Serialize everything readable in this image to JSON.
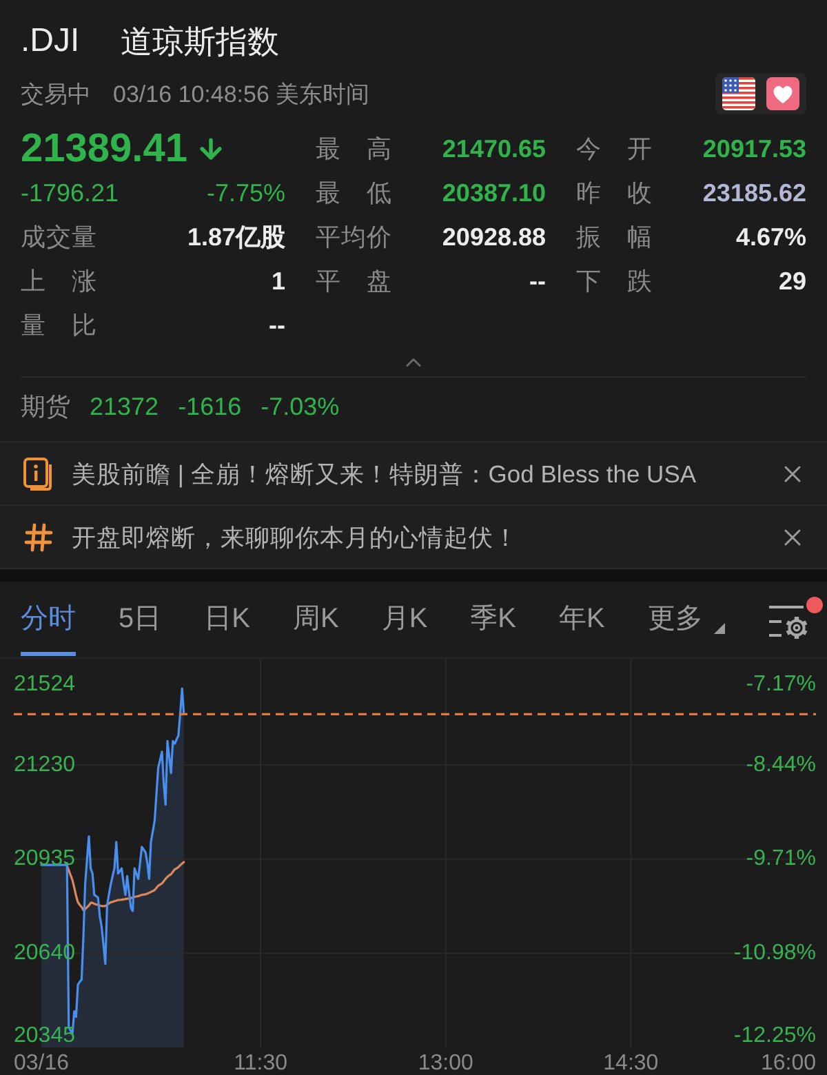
{
  "header": {
    "symbol": ".DJI",
    "name": "道琼斯指数",
    "status": "交易中",
    "timestamp": "03/16 10:48:56 美东时间",
    "favorited": true
  },
  "quote": {
    "price": "21389.41",
    "falling": true,
    "change": "-1796.21",
    "change_percent": "-7.75%"
  },
  "stats": [
    {
      "label": "最 高",
      "value": "21470.65",
      "color": "#2fb44c"
    },
    {
      "label": "今 开",
      "value": "20917.53",
      "color": "#2fb44c"
    },
    {
      "label": "最 低",
      "value": "20387.10",
      "color": "#2fb44c"
    },
    {
      "label": "昨 收",
      "value": "23185.62",
      "color": "#b4b7d6"
    },
    {
      "label": "成交量",
      "value": "1.87亿股",
      "color": "#ececec"
    },
    {
      "label": "平均价",
      "value": "20928.88",
      "color": "#ececec"
    },
    {
      "label": "振 幅",
      "value": "4.67%",
      "color": "#ececec"
    },
    {
      "label": "上 涨",
      "value": "1",
      "color": "#ececec"
    },
    {
      "label": "平 盘",
      "value": "--",
      "color": "#ececec"
    },
    {
      "label": "下 跌",
      "value": "29",
      "color": "#ececec"
    },
    {
      "label": "量 比",
      "value": "--",
      "color": "#ececec"
    }
  ],
  "futures": {
    "label": "期货",
    "price": "21372",
    "change": "-1616",
    "change_percent": "-7.03%",
    "falling": true
  },
  "news": [
    {
      "kind": "info",
      "text": "美股前瞻 | 全崩！熔断又来！特朗普：God Bless the USA"
    },
    {
      "kind": "topic",
      "text": "开盘即熔断，来聊聊你本月的心情起伏！"
    }
  ],
  "chart_tabs": {
    "items": [
      {
        "label": "分时",
        "selected": true,
        "kind": "period"
      },
      {
        "label": "5日",
        "selected": false,
        "kind": "period"
      },
      {
        "label": "日K",
        "selected": false,
        "kind": "period"
      },
      {
        "label": "周K",
        "selected": false,
        "kind": "period"
      },
      {
        "label": "月K",
        "selected": false,
        "kind": "period"
      },
      {
        "label": "季K",
        "selected": false,
        "kind": "period"
      },
      {
        "label": "年K",
        "selected": false,
        "kind": "period"
      },
      {
        "label": "更多",
        "selected": false,
        "kind": "menu"
      }
    ],
    "settings_notice": true
  },
  "chart": {
    "percent_labels": [
      "-7.17%",
      "-8.44%",
      "-9.71%",
      "-10.98%",
      "-12.25%"
    ],
    "chart_data": {
      "type": "line",
      "grid": true,
      "categories": [
        "03/16",
        null,
        null,
        null,
        null,
        null,
        null,
        null,
        null,
        null,
        null,
        null,
        null,
        null,
        null,
        null,
        null,
        null,
        null,
        null,
        null,
        null,
        null,
        null,
        null,
        null,
        null,
        null,
        null,
        null,
        null,
        null,
        null,
        null,
        null,
        null,
        null,
        null,
        null,
        null,
        null,
        null,
        null,
        null,
        null,
        null,
        null,
        null,
        null,
        null,
        null,
        null,
        null,
        null,
        null,
        null,
        null,
        null,
        null,
        null,
        null,
        null,
        null,
        null,
        null,
        null,
        null,
        null,
        null,
        null,
        null,
        null,
        null,
        null,
        null,
        null,
        null,
        null,
        null,
        null,
        null,
        null,
        null,
        null,
        null,
        null,
        null,
        null,
        null,
        null,
        null,
        null,
        null,
        null,
        null,
        null,
        null,
        null,
        null,
        null,
        null,
        null,
        null,
        null,
        null,
        null,
        null,
        null,
        null,
        null,
        null,
        null,
        null,
        null,
        null,
        null,
        null,
        null,
        null,
        null,
        "11:30",
        null,
        null,
        null,
        null,
        null,
        null,
        null,
        null,
        null,
        null,
        null,
        null,
        null,
        null,
        null,
        null,
        null,
        null,
        null,
        null,
        null,
        null,
        null,
        null,
        null,
        null,
        null,
        null,
        null,
        null,
        null,
        null,
        null,
        null,
        null,
        null,
        null,
        null,
        null,
        null,
        null,
        null,
        null,
        null,
        null,
        null,
        null,
        null,
        null,
        null,
        null,
        null,
        null,
        null,
        null,
        null,
        null,
        null,
        null,
        null,
        null,
        null,
        null,
        null,
        null,
        null,
        null,
        null,
        null,
        null,
        null,
        null,
        null,
        null,
        null,
        null,
        null,
        null,
        null,
        null,
        null,
        null,
        null,
        null,
        null,
        null,
        null,
        null,
        null,
        "13:00",
        null,
        null,
        null,
        null,
        null,
        null,
        null,
        null,
        null,
        null,
        null,
        null,
        null,
        null,
        null,
        null,
        null,
        null,
        null,
        null,
        null,
        null,
        null,
        null,
        null,
        null,
        null,
        null,
        null,
        null,
        null,
        null,
        null,
        null,
        null,
        null,
        null,
        null,
        null,
        null,
        null,
        null,
        null,
        null,
        null,
        null,
        null,
        null,
        null,
        null,
        null,
        null,
        null,
        null,
        null,
        null,
        null,
        null,
        null,
        null,
        null,
        null,
        null,
        null,
        null,
        null,
        null,
        null,
        null,
        null,
        null,
        null,
        null,
        null,
        null,
        null,
        null,
        null,
        null,
        null,
        null,
        null,
        null,
        null,
        null,
        null,
        null,
        null,
        null,
        "14:30",
        null,
        null,
        null,
        null,
        null,
        null,
        null,
        null,
        null,
        null,
        null,
        null,
        null,
        null,
        null,
        null,
        null,
        null,
        null,
        null,
        null,
        null,
        null,
        null,
        null,
        null,
        null,
        null,
        null,
        null,
        null,
        null,
        null,
        null,
        null,
        null,
        null,
        null,
        null,
        null,
        null,
        null,
        null,
        null,
        null,
        null,
        null,
        null,
        null,
        null,
        null,
        null,
        null,
        null,
        null,
        null,
        null,
        null,
        null,
        null,
        null,
        null,
        null,
        null,
        null,
        null,
        null,
        null,
        null,
        null,
        null,
        null,
        null,
        null,
        null,
        null,
        null,
        null,
        null,
        null,
        null,
        null,
        null,
        null,
        null,
        null,
        null,
        null,
        null,
        "16:00"
      ],
      "series": [
        {
          "color": "#4a8ff0",
          "values": [
            20917,
            20917,
            20917,
            20917,
            20917,
            20917,
            20917,
            20917,
            20917,
            20917,
            20917,
            20917,
            20917,
            20917,
            20923,
            20408,
            20398,
            20387,
            20458,
            20441,
            20541,
            20550,
            20558,
            20691,
            20857,
            20932,
            21006,
            20906,
            20890,
            20823,
            20819,
            20815,
            20757,
            20724,
            20666,
            20607,
            20790,
            20823,
            20857,
            20882,
            20906,
            20989,
            20890,
            20898,
            20906,
            20857,
            20823,
            20882,
            20832,
            20782,
            20773,
            20906,
            20890,
            20873,
            20923,
            20973,
            20965,
            20956,
            20923,
            20873,
            20989,
            21023,
            21056,
            21139,
            21222,
            21247,
            21272,
            21172,
            21106,
            21305,
            21255,
            21205,
            21305,
            21297,
            21310,
            21322,
            21388,
            21470,
            21389,
            null,
            null,
            null,
            null,
            null,
            null,
            null,
            null,
            null,
            null,
            null,
            null,
            null,
            null,
            null,
            null,
            null,
            null,
            null,
            null,
            null,
            null,
            null,
            null,
            null,
            null,
            null,
            null,
            null,
            null,
            null,
            null,
            null,
            null,
            null,
            null,
            null,
            null,
            null,
            null,
            null,
            null,
            null,
            null,
            null,
            null,
            null,
            null,
            null,
            null,
            null,
            null,
            null,
            null,
            null,
            null,
            null,
            null,
            null,
            null,
            null,
            null,
            null,
            null,
            null,
            null,
            null,
            null,
            null,
            null,
            null,
            null,
            null,
            null,
            null,
            null,
            null,
            null,
            null,
            null,
            null,
            null,
            null,
            null,
            null,
            null,
            null,
            null,
            null,
            null,
            null,
            null,
            null,
            null,
            null,
            null,
            null,
            null,
            null,
            null,
            null,
            null,
            null,
            null,
            null,
            null,
            null,
            null,
            null,
            null,
            null,
            null,
            null,
            null,
            null,
            null,
            null,
            null,
            null,
            null,
            null,
            null,
            null,
            null,
            null,
            null,
            null,
            null,
            null,
            null,
            null,
            null,
            null,
            null,
            null,
            null,
            null,
            null,
            null,
            null,
            null,
            null,
            null,
            null,
            null,
            null,
            null,
            null,
            null,
            null,
            null,
            null,
            null,
            null,
            null,
            null,
            null,
            null,
            null,
            null,
            null,
            null,
            null,
            null,
            null,
            null,
            null,
            null,
            null,
            null,
            null,
            null,
            null,
            null,
            null,
            null,
            null,
            null,
            null,
            null,
            null,
            null,
            null,
            null,
            null,
            null,
            null,
            null,
            null,
            null,
            null,
            null,
            null,
            null,
            null,
            null,
            null,
            null,
            null,
            null,
            null,
            null,
            null,
            null,
            null,
            null,
            null,
            null,
            null,
            null,
            null,
            null,
            null,
            null,
            null,
            null,
            null,
            null,
            null,
            null,
            null,
            null,
            null,
            null,
            null,
            null,
            null,
            null,
            null,
            null,
            null,
            null,
            null,
            null,
            null,
            null,
            null,
            null,
            null,
            null,
            null,
            null,
            null,
            null,
            null,
            null,
            null,
            null,
            null,
            null,
            null,
            null,
            null,
            null,
            null,
            null,
            null,
            null,
            null,
            null,
            null,
            null,
            null,
            null,
            null,
            null,
            null,
            null,
            null,
            null,
            null,
            null,
            null,
            null,
            null,
            null,
            null,
            null,
            null,
            null,
            null,
            null,
            null,
            null,
            null,
            null,
            null,
            null,
            null,
            null,
            null,
            null,
            null,
            null,
            null,
            null,
            null,
            null,
            null,
            null,
            null,
            null,
            null,
            null,
            null,
            null,
            null,
            null,
            null,
            null,
            null,
            null
          ]
        },
        {
          "color": "#e0875a",
          "values": [
            null,
            null,
            null,
            null,
            null,
            null,
            null,
            null,
            null,
            null,
            null,
            null,
            null,
            null,
            20915,
            20900,
            20885,
            20870,
            20845,
            20820,
            20800,
            20792,
            20785,
            20775,
            20778,
            20784,
            20790,
            20798,
            20798,
            20795,
            20793,
            20792,
            20790,
            20788,
            20788,
            20788,
            20792,
            20796,
            20800,
            20801,
            20803,
            20805,
            20807,
            20807,
            20808,
            20809,
            20810,
            20811,
            20812,
            20813,
            20815,
            20817,
            20818,
            20819,
            20821,
            20823,
            20824,
            20825,
            20827,
            20830,
            20832,
            20835,
            20838,
            20845,
            20852,
            20855,
            20859,
            20866,
            20873,
            20880,
            20884,
            20888,
            20895,
            20903,
            20906,
            20910,
            20916,
            20921,
            20926,
            null,
            null,
            null,
            null,
            null,
            null,
            null,
            null,
            null,
            null,
            null,
            null,
            null,
            null,
            null,
            null,
            null,
            null,
            null,
            null,
            null,
            null,
            null,
            null,
            null,
            null,
            null,
            null,
            null,
            null,
            null,
            null,
            null,
            null,
            null,
            null,
            null,
            null,
            null,
            null,
            null,
            null,
            null,
            null,
            null,
            null,
            null,
            null,
            null,
            null,
            null,
            null,
            null,
            null,
            null,
            null,
            null,
            null,
            null,
            null,
            null,
            null,
            null,
            null,
            null,
            null,
            null,
            null,
            null,
            null,
            null,
            null,
            null,
            null,
            null,
            null,
            null,
            null,
            null,
            null,
            null,
            null,
            null,
            null,
            null,
            null,
            null,
            null,
            null,
            null,
            null,
            null,
            null,
            null,
            null,
            null,
            null,
            null,
            null,
            null,
            null,
            null,
            null,
            null,
            null,
            null,
            null,
            null,
            null,
            null,
            null,
            null,
            null,
            null,
            null,
            null,
            null,
            null,
            null,
            null,
            null,
            null,
            null,
            null,
            null,
            null,
            null,
            null,
            null,
            null,
            null,
            null,
            null,
            null,
            null,
            null,
            null,
            null,
            null,
            null,
            null,
            null,
            null,
            null,
            null,
            null,
            null,
            null,
            null,
            null,
            null,
            null,
            null,
            null,
            null,
            null,
            null,
            null,
            null,
            null,
            null,
            null,
            null,
            null,
            null,
            null,
            null,
            null,
            null,
            null,
            null,
            null,
            null,
            null,
            null,
            null,
            null,
            null,
            null,
            null,
            null,
            null,
            null,
            null,
            null,
            null,
            null,
            null,
            null,
            null,
            null,
            null,
            null,
            null,
            null,
            null,
            null,
            null,
            null,
            null,
            null,
            null,
            null,
            null,
            null,
            null,
            null,
            null,
            null,
            null,
            null,
            null,
            null,
            null,
            null,
            null,
            null,
            null,
            null,
            null,
            null,
            null,
            null,
            null,
            null,
            null,
            null,
            null,
            null,
            null,
            null,
            null,
            null,
            null,
            null,
            null,
            null,
            null,
            null,
            null,
            null,
            null,
            null,
            null,
            null,
            null,
            null,
            null,
            null,
            null,
            null,
            null,
            null,
            null,
            null,
            null,
            null,
            null,
            null,
            null,
            null,
            null,
            null,
            null,
            null,
            null,
            null,
            null,
            null,
            null,
            null,
            null,
            null,
            null,
            null,
            null,
            null,
            null,
            null,
            null,
            null,
            null,
            null,
            null,
            null,
            null,
            null,
            null,
            null,
            null,
            null,
            null,
            null,
            null,
            null,
            null,
            null,
            null,
            null,
            null,
            null,
            null,
            null,
            null,
            null,
            null,
            null,
            null,
            null,
            null,
            null,
            null
          ]
        }
      ],
      "ylim": [
        20345,
        21524
      ],
      "yticks": [
        20345,
        20640,
        20935,
        21230,
        21524
      ],
      "ref_lines": [
        {
          "axis": "y",
          "value": 21389.41
        }
      ]
    }
  }
}
